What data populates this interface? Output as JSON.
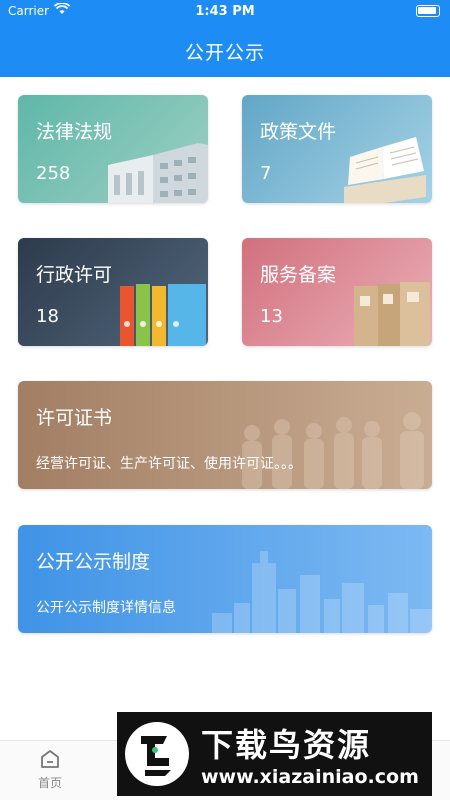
{
  "status_bar": {
    "carrier": "Carrier",
    "time": "1:43 PM"
  },
  "header": {
    "title": "公开公示"
  },
  "cards": [
    {
      "title": "法律法规",
      "count": "258"
    },
    {
      "title": "政策文件",
      "count": "7"
    },
    {
      "title": "行政许可",
      "count": "18"
    },
    {
      "title": "服务备案",
      "count": "13"
    }
  ],
  "wide_cards": [
    {
      "title": "许可证书",
      "subtitle": "经营许可证、生产许可证、使用许可证。。。"
    },
    {
      "title": "公开公示制度",
      "subtitle": "公开公示制度详情信息"
    }
  ],
  "tabbar": {
    "items": [
      {
        "label": "首页",
        "icon": "home-icon"
      }
    ]
  },
  "watermark": {
    "name": "下载鸟资源",
    "url": "www.xiazainiao.com"
  },
  "colors": {
    "header": "#1e8cf5",
    "tab_active": "#1e8cf5"
  }
}
